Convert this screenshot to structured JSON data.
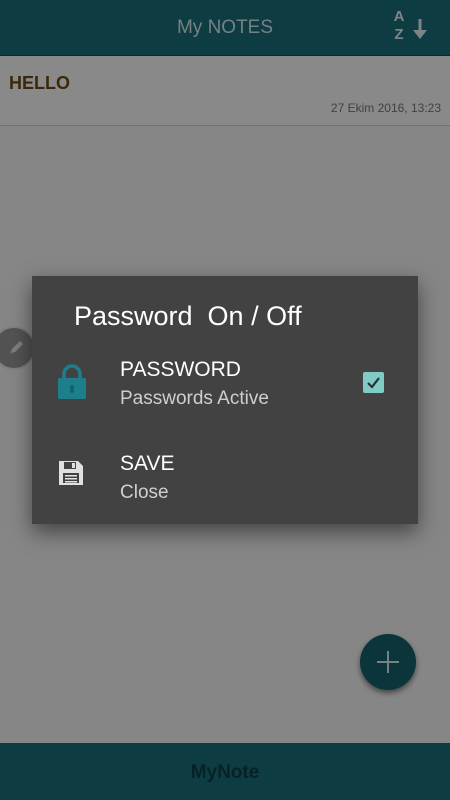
{
  "appbar": {
    "title": "My NOTES",
    "sort_letter_top": "A",
    "sort_letter_bottom": "Z",
    "sort_icon": "sort-az-icon",
    "color": "#1a6e7a"
  },
  "notes": [
    {
      "title": "HELLO",
      "date": "27 Ekim 2016, 13:23"
    }
  ],
  "dialog": {
    "title": "Password  On / Off",
    "items": [
      {
        "icon": "lock-icon",
        "primary": "PASSWORD",
        "secondary": "Passwords Active",
        "checked": true
      },
      {
        "icon": "save-icon",
        "primary": "SAVE",
        "secondary": "Close"
      }
    ],
    "checkbox_color": "#80cbc4"
  },
  "edit_button": {
    "icon": "pencil-icon"
  },
  "fab": {
    "icon": "plus-icon"
  },
  "bottombar": {
    "label": "MyNote"
  }
}
